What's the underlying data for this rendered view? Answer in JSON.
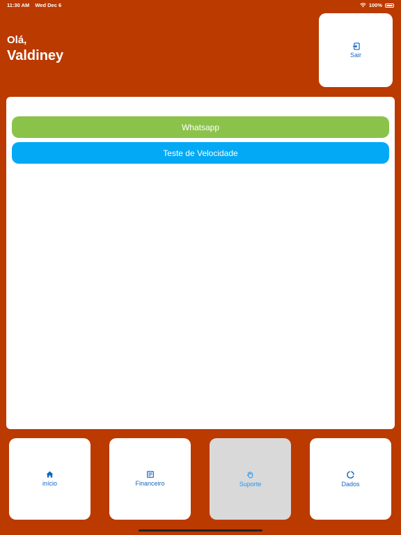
{
  "status_bar": {
    "time": "11:30 AM",
    "date": "Wed Dec 6",
    "battery": "100%"
  },
  "header": {
    "greeting": "Olá,",
    "user_name": "Valdiney"
  },
  "logout": {
    "label": "Sair",
    "icon": "logout-icon"
  },
  "content": {
    "buttons": [
      {
        "label": "Whatsapp",
        "color": "#8bc34a"
      },
      {
        "label": "Teste de Velocidade",
        "color": "#03a9f4"
      }
    ]
  },
  "bottom_nav": {
    "items": [
      {
        "label": "início",
        "icon": "home-icon"
      },
      {
        "label": "Financeiro",
        "icon": "document-icon"
      },
      {
        "label": "Suporte",
        "icon": "support-hand-icon",
        "active": true
      },
      {
        "label": "Dados",
        "icon": "data-usage-icon"
      }
    ]
  },
  "colors": {
    "background": "#bb3a00",
    "accent": "#1565c0",
    "active_tab_bg": "#d9d9d9"
  }
}
